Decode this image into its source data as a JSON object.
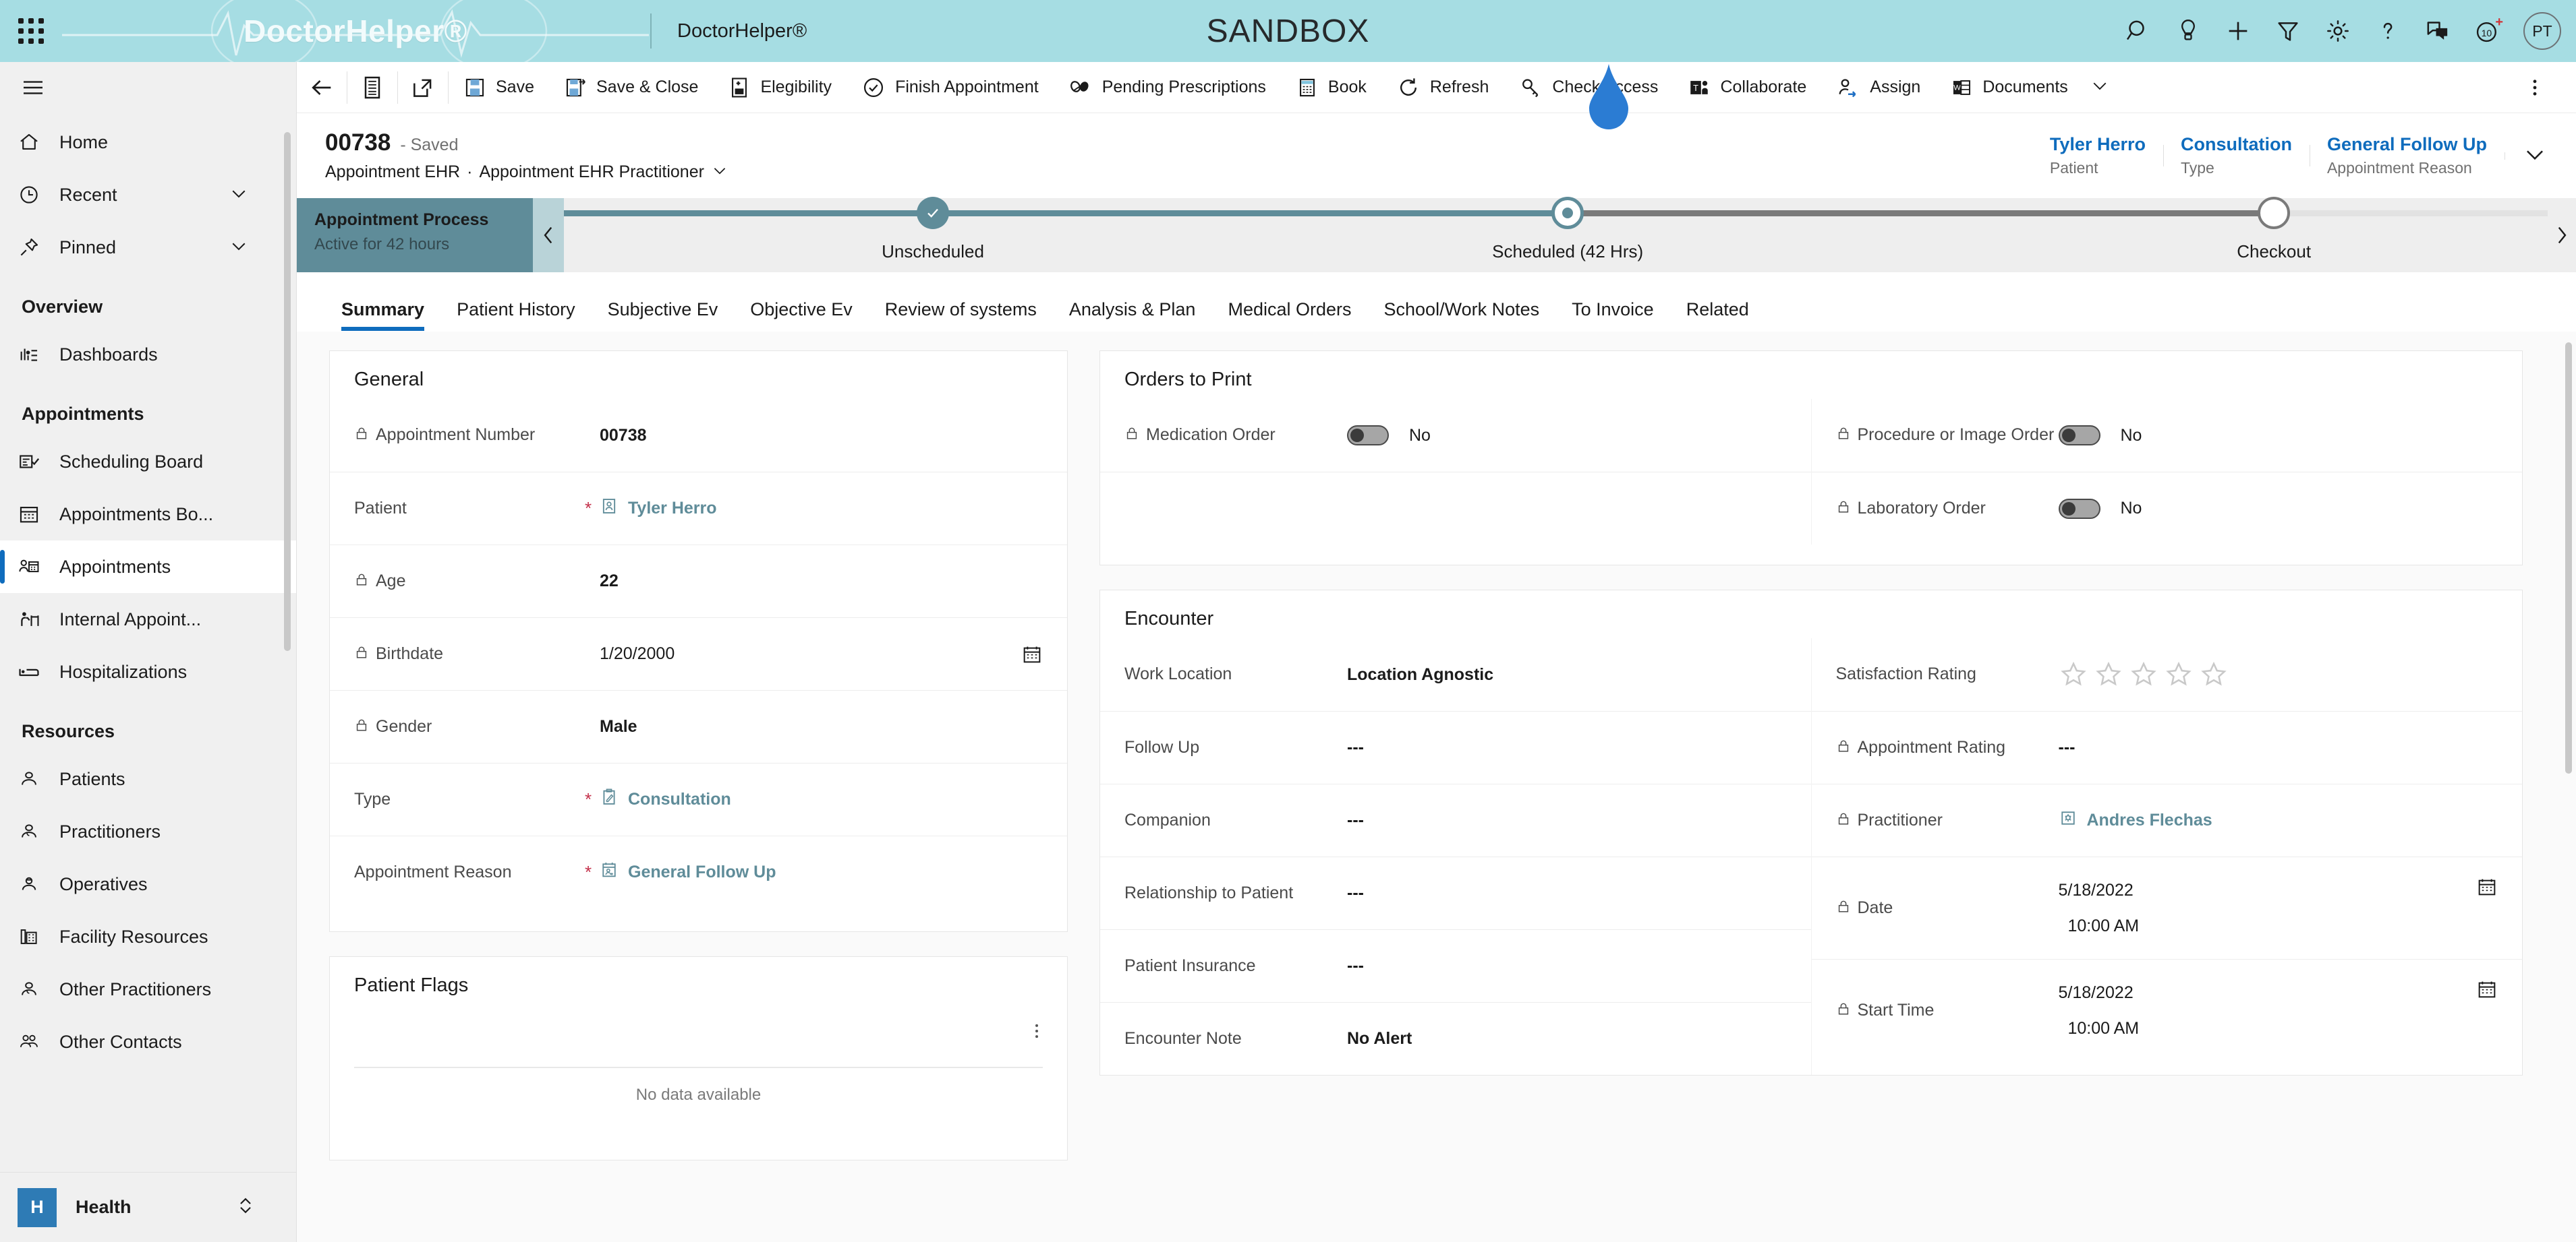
{
  "topbar": {
    "waffle_label": "app-launcher",
    "logo_text": "DoctorHelper®",
    "app_name": "DoctorHelper®",
    "environment": "SANDBOX",
    "actions": [
      {
        "name": "search-icon",
        "label": "Search"
      },
      {
        "name": "insights-icon",
        "label": "Insights"
      },
      {
        "name": "quick-create-icon",
        "label": "New"
      },
      {
        "name": "filter-icon",
        "label": "Filter"
      },
      {
        "name": "settings-gear-icon",
        "label": "Settings"
      },
      {
        "name": "help-icon",
        "label": "Help"
      },
      {
        "name": "feedback-icon",
        "label": "Feedback"
      },
      {
        "name": "assistant-icon",
        "label": "Assistant"
      }
    ],
    "notification_count": "10",
    "avatar_initials": "PT"
  },
  "sidebar": {
    "hamburger_label": "Expand navigation",
    "top_items": [
      {
        "name": "sidebar-item-home",
        "label": "Home",
        "icon": "home-icon",
        "chevron": false
      },
      {
        "name": "sidebar-item-recent",
        "label": "Recent",
        "icon": "clock-icon",
        "chevron": true
      },
      {
        "name": "sidebar-item-pinned",
        "label": "Pinned",
        "icon": "pin-icon",
        "chevron": true
      }
    ],
    "groups": [
      {
        "title": "Overview",
        "items": [
          {
            "name": "sidebar-item-dashboards",
            "label": "Dashboards",
            "icon": "dashboard-icon",
            "selected": false
          }
        ]
      },
      {
        "title": "Appointments",
        "items": [
          {
            "name": "sidebar-item-scheduling-board",
            "label": "Scheduling Board",
            "icon": "scheduling-board-icon",
            "selected": false
          },
          {
            "name": "sidebar-item-appointments-board",
            "label": "Appointments Bo...",
            "icon": "calendar-icon",
            "selected": false
          },
          {
            "name": "sidebar-item-appointments",
            "label": "Appointments",
            "icon": "appointment-person-icon",
            "selected": true
          },
          {
            "name": "sidebar-item-internal-appointments",
            "label": "Internal Appoint...",
            "icon": "internal-appointment-icon",
            "selected": false
          },
          {
            "name": "sidebar-item-hospitalizations",
            "label": "Hospitalizations",
            "icon": "bed-icon",
            "selected": false
          }
        ]
      },
      {
        "title": "Resources",
        "items": [
          {
            "name": "sidebar-item-patients",
            "label": "Patients",
            "icon": "patient-icon",
            "selected": false
          },
          {
            "name": "sidebar-item-practitioners",
            "label": "Practitioners",
            "icon": "practitioner-icon",
            "selected": false
          },
          {
            "name": "sidebar-item-operatives",
            "label": "Operatives",
            "icon": "operative-icon",
            "selected": false
          },
          {
            "name": "sidebar-item-facility-resources",
            "label": "Facility Resources",
            "icon": "building-icon",
            "selected": false
          },
          {
            "name": "sidebar-item-other-practitioners",
            "label": "Other Practitioners",
            "icon": "practitioner-icon",
            "selected": false
          },
          {
            "name": "sidebar-item-other-contacts",
            "label": "Other Contacts",
            "icon": "contacts-icon",
            "selected": false
          }
        ]
      }
    ],
    "area_switcher": {
      "badge": "H",
      "label": "Health"
    }
  },
  "commandbar": {
    "back_label": "Back",
    "items": [
      {
        "name": "save-button",
        "label": "Save",
        "icon": "save-icon"
      },
      {
        "name": "save-and-close-button",
        "label": "Save & Close",
        "icon": "save-close-icon"
      },
      {
        "name": "elegibility-button",
        "label": "Elegibility",
        "icon": "document-plus-icon"
      },
      {
        "name": "finish-appointment-button",
        "label": "Finish Appointment",
        "icon": "check-circle-icon"
      },
      {
        "name": "pending-prescriptions-button",
        "label": "Pending Prescriptions",
        "icon": "prescription-icon"
      },
      {
        "name": "book-button",
        "label": "Book",
        "icon": "book-calendar-icon"
      },
      {
        "name": "refresh-button",
        "label": "Refresh",
        "icon": "refresh-icon"
      },
      {
        "name": "check-access-button",
        "label": "Check Access",
        "icon": "key-icon"
      },
      {
        "name": "collaborate-button",
        "label": "Collaborate",
        "icon": "teams-icon"
      },
      {
        "name": "assign-button",
        "label": "Assign",
        "icon": "assign-person-icon"
      },
      {
        "name": "documents-button",
        "label": "Documents",
        "icon": "word-doc-icon",
        "chevron": true
      }
    ],
    "overflow_label": "More commands"
  },
  "record_header": {
    "number": "00738",
    "state": "- Saved",
    "entity": "Appointment EHR",
    "separator": "·",
    "form_name": "Appointment EHR Practitioner",
    "fields": [
      {
        "name": "header-field-patient",
        "value": "Tyler Herro",
        "label": "Patient"
      },
      {
        "name": "header-field-type",
        "value": "Consultation",
        "label": "Type"
      },
      {
        "name": "header-field-appointment-reason",
        "value": "General Follow Up",
        "label": "Appointment Reason"
      }
    ]
  },
  "process_flow": {
    "title": "Appointment Process",
    "subtitle": "Active for 42 hours",
    "stages": [
      {
        "name": "bpf-stage-unscheduled",
        "label": "Unscheduled",
        "state": "completed"
      },
      {
        "name": "bpf-stage-scheduled",
        "label": "Scheduled  (42 Hrs)",
        "state": "active"
      },
      {
        "name": "bpf-stage-checkout",
        "label": "Checkout",
        "state": "future"
      }
    ]
  },
  "tabs": [
    {
      "name": "tab-summary",
      "label": "Summary",
      "active": true
    },
    {
      "name": "tab-patient-history",
      "label": "Patient History",
      "active": false
    },
    {
      "name": "tab-subjective-ev",
      "label": "Subjective Ev",
      "active": false
    },
    {
      "name": "tab-objective-ev",
      "label": "Objective Ev",
      "active": false
    },
    {
      "name": "tab-review-of-systems",
      "label": "Review of systems",
      "active": false
    },
    {
      "name": "tab-analysis-and-plan",
      "label": "Analysis & Plan",
      "active": false
    },
    {
      "name": "tab-medical-orders",
      "label": "Medical Orders",
      "active": false
    },
    {
      "name": "tab-school-work-notes",
      "label": "School/Work Notes",
      "active": false
    },
    {
      "name": "tab-to-invoice",
      "label": "To Invoice",
      "active": false
    },
    {
      "name": "tab-related",
      "label": "Related",
      "active": false
    }
  ],
  "general_section": {
    "title": "General",
    "fields": [
      {
        "name": "field-appointment-number",
        "label": "Appointment Number",
        "value": "00738",
        "locked": true,
        "required": false,
        "bold": true
      },
      {
        "name": "field-patient",
        "label": "Patient",
        "value": "Tyler Herro",
        "locked": false,
        "required": true,
        "link": true,
        "icon": "contact-card-icon"
      },
      {
        "name": "field-age",
        "label": "Age",
        "value": "22",
        "locked": true,
        "required": false,
        "bold": true
      },
      {
        "name": "field-birthdate",
        "label": "Birthdate",
        "value": "1/20/2000",
        "locked": true,
        "required": false,
        "trailing_icon": "calendar-icon"
      },
      {
        "name": "field-gender",
        "label": "Gender",
        "value": "Male",
        "locked": true,
        "required": false,
        "bold": true
      },
      {
        "name": "field-type",
        "label": "Type",
        "value": "Consultation",
        "locked": false,
        "required": true,
        "link": true,
        "icon": "clipboard-pen-icon"
      },
      {
        "name": "field-appointment-reason",
        "label": "Appointment Reason",
        "value": "General Follow Up",
        "locked": false,
        "required": true,
        "link": true,
        "icon": "calendar-person-icon"
      }
    ]
  },
  "patient_flags": {
    "title": "Patient Flags",
    "kebab_label": "More options",
    "empty_text": "No data available"
  },
  "orders_to_print": {
    "title": "Orders to Print",
    "left_fields": [
      {
        "name": "toggle-medication-order",
        "label": "Medication Order",
        "value": "No",
        "locked": true
      }
    ],
    "right_fields": [
      {
        "name": "toggle-procedure-or-image-order",
        "label": "Procedure or Image Order",
        "value": "No",
        "locked": true
      },
      {
        "name": "toggle-laboratory-order",
        "label": "Laboratory Order",
        "value": "No",
        "locked": true
      }
    ]
  },
  "encounter": {
    "title": "Encounter",
    "left_fields": [
      {
        "name": "field-work-location",
        "label": "Work Location",
        "value": "Location Agnostic",
        "locked": false,
        "bold": true
      },
      {
        "name": "field-follow-up",
        "label": "Follow Up",
        "value": "---",
        "locked": false,
        "bold": true
      },
      {
        "name": "field-companion",
        "label": "Companion",
        "value": "---",
        "locked": false,
        "bold": true
      },
      {
        "name": "field-relationship-to-patient",
        "label": "Relationship to Patient",
        "value": "---",
        "locked": false,
        "bold": true
      },
      {
        "name": "field-patient-insurance",
        "label": "Patient Insurance",
        "value": "---",
        "locked": false,
        "bold": true
      },
      {
        "name": "field-encounter-note",
        "label": "Encounter Note",
        "value": "No Alert",
        "locked": false,
        "bold": true
      }
    ],
    "right_fields": [
      {
        "name": "field-satisfaction-rating",
        "label": "Satisfaction Rating",
        "value": "",
        "locked": false,
        "stars": 5,
        "stars_filled": 0
      },
      {
        "name": "field-appointment-rating",
        "label": "Appointment Rating",
        "value": "---",
        "locked": true,
        "bold": true
      },
      {
        "name": "field-practitioner",
        "label": "Practitioner",
        "value": "Andres Flechas",
        "locked": true,
        "link": true,
        "icon": "practitioner-card-icon"
      },
      {
        "name": "field-date",
        "label": "Date",
        "value": "5/18/2022",
        "value2": "10:00 AM",
        "locked": true,
        "trailing_icon": "calendar-icon"
      },
      {
        "name": "field-start-time",
        "label": "Start Time",
        "value": "5/18/2022",
        "value2": "10:00 AM",
        "locked": true,
        "trailing_icon": "calendar-icon"
      }
    ]
  },
  "colors": {
    "brand_bar": "#a6dde3",
    "accent_link": "#0f6cbd",
    "teal_link": "#5f8c99",
    "process_active": "#5f8c99",
    "required_star": "#c4314b",
    "pointer": "#2b7cd3"
  }
}
